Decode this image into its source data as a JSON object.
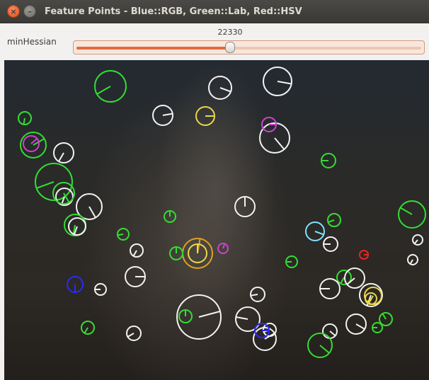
{
  "window": {
    "title": "Feature Points - Blue::RGB, Green::Lab, Red::HSV",
    "close_glyph": "×",
    "minimize_glyph": "–"
  },
  "trackbar": {
    "label": "minHessian",
    "value": "22330",
    "fraction": 0.445
  },
  "colors": {
    "rgb_blue": "#2a2aff",
    "lab_green": "#33dd33",
    "hsv_red": "#ee2222",
    "overlap_white": "#f2f2f2",
    "accent_orange": "#e06b3c"
  }
}
